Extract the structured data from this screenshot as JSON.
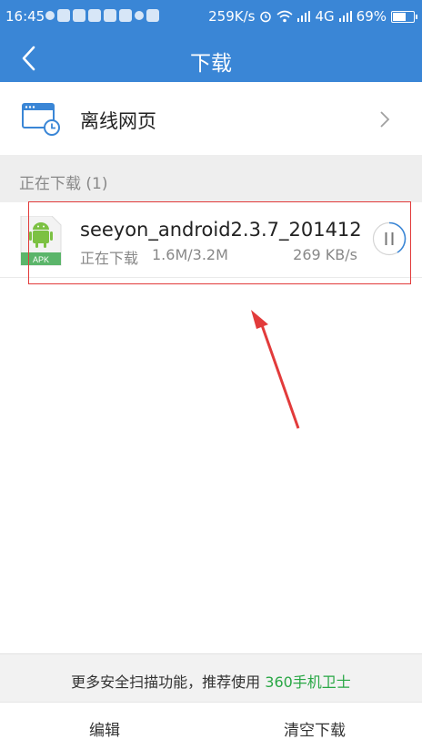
{
  "status_bar": {
    "time": "16:45",
    "speed": "259K/s",
    "network": "4G",
    "battery": "69%",
    "battery_level": 0.69
  },
  "header": {
    "title": "下载"
  },
  "offline": {
    "label": "离线网页"
  },
  "section": {
    "title": "正在下载 (1)"
  },
  "download": {
    "icon_label": "APK",
    "file_name": "seeyon_android2.3.7_201412...",
    "status": "正在下载",
    "size": "1.6M/3.2M",
    "speed": "269 KB/s"
  },
  "promo": {
    "text": "更多安全扫描功能，推荐使用 ",
    "brand": "360手机卫士",
    "brand_color": "#29a745"
  },
  "toolbar": {
    "edit": "编辑",
    "clear": "清空下载"
  },
  "colors": {
    "accent": "#3a86d6",
    "annotation": "#e23b3b"
  }
}
